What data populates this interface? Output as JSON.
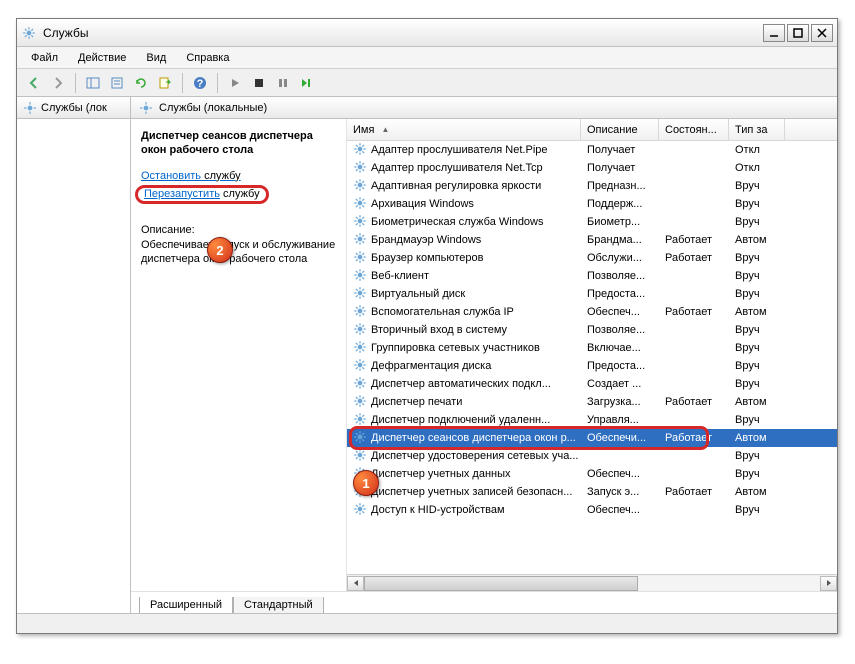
{
  "window": {
    "title": "Службы"
  },
  "menu": {
    "file": "Файл",
    "action": "Действие",
    "view": "Вид",
    "help": "Справка"
  },
  "nav": {
    "label": "Службы (лок"
  },
  "mainHeader": "Службы (локальные)",
  "detail": {
    "title": "Диспетчер сеансов диспетчера окон рабочего стола",
    "stopLink": "Остановить",
    "stopSuffix": " службу",
    "restartLink": "Перезапустить",
    "restartSuffix": " службу",
    "descHead": "Описание:",
    "descBody": "Обеспечивает запуск и обслуживание диспетчера окон рабочего стола"
  },
  "columns": {
    "name": "Имя",
    "desc": "Описание",
    "state": "Состоян...",
    "type": "Тип за"
  },
  "selectedIndex": 16,
  "services": [
    {
      "name": "Адаптер прослушивателя Net.Pipe",
      "desc": "Получает",
      "state": "",
      "type": "Откл"
    },
    {
      "name": "Адаптер прослушивателя Net.Tcp",
      "desc": "Получает",
      "state": "",
      "type": "Откл"
    },
    {
      "name": "Адаптивная регулировка яркости",
      "desc": "Предназн...",
      "state": "",
      "type": "Вруч"
    },
    {
      "name": "Архивация Windows",
      "desc": "Поддерж...",
      "state": "",
      "type": "Вруч"
    },
    {
      "name": "Биометрическая служба Windows",
      "desc": "Биометр...",
      "state": "",
      "type": "Вруч"
    },
    {
      "name": "Брандмауэр Windows",
      "desc": "Брандма...",
      "state": "Работает",
      "type": "Автом"
    },
    {
      "name": "Браузер компьютеров",
      "desc": "Обслужи...",
      "state": "Работает",
      "type": "Вруч"
    },
    {
      "name": "Веб-клиент",
      "desc": "Позволяе...",
      "state": "",
      "type": "Вруч"
    },
    {
      "name": "Виртуальный диск",
      "desc": "Предоста...",
      "state": "",
      "type": "Вруч"
    },
    {
      "name": "Вспомогательная служба IP",
      "desc": "Обеспеч...",
      "state": "Работает",
      "type": "Автом"
    },
    {
      "name": "Вторичный вход в систему",
      "desc": "Позволяе...",
      "state": "",
      "type": "Вруч"
    },
    {
      "name": "Группировка сетевых участников",
      "desc": "Включае...",
      "state": "",
      "type": "Вруч"
    },
    {
      "name": "Дефрагментация диска",
      "desc": "Предоста...",
      "state": "",
      "type": "Вруч"
    },
    {
      "name": "Диспетчер автоматических подкл...",
      "desc": "Создает ...",
      "state": "",
      "type": "Вруч"
    },
    {
      "name": "Диспетчер печати",
      "desc": "Загрузка...",
      "state": "Работает",
      "type": "Автом"
    },
    {
      "name": "Диспетчер подключений удаленн...",
      "desc": "Управля...",
      "state": "",
      "type": "Вруч"
    },
    {
      "name": "Диспетчер сеансов диспетчера окон р...",
      "desc": "Обеспечи...",
      "state": "Работает",
      "type": "Автом"
    },
    {
      "name": "Диспетчер удостоверения сетевых уча...",
      "desc": "",
      "state": "",
      "type": "Вруч"
    },
    {
      "name": "Диспетчер учетных данных",
      "desc": "Обеспеч...",
      "state": "",
      "type": "Вруч"
    },
    {
      "name": "Диспетчер учетных записей безопасн...",
      "desc": "Запуск э...",
      "state": "Работает",
      "type": "Автом"
    },
    {
      "name": "Доступ к HID-устройствам",
      "desc": "Обеспеч...",
      "state": "",
      "type": "Вруч"
    }
  ],
  "tabs": {
    "extended": "Расширенный",
    "standard": "Стандартный"
  },
  "markers": {
    "one": "1",
    "two": "2"
  }
}
